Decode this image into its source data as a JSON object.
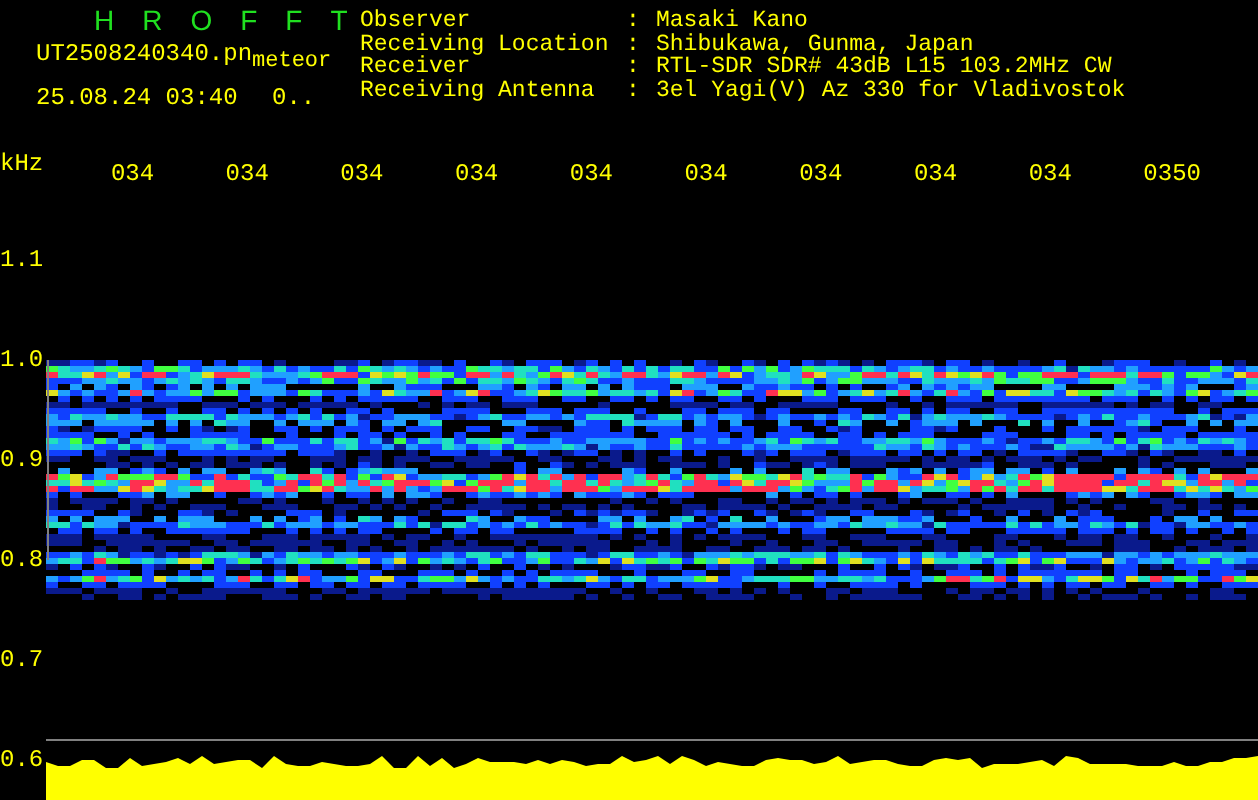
{
  "title": "HROFFT",
  "file": {
    "name": "UT2508240340.pn",
    "tag": "meteor",
    "date": "25.08.24 03:40",
    "count": "0.."
  },
  "info": [
    {
      "label": "Observer",
      "separator": ":",
      "value": "Masaki Kano"
    },
    {
      "label": "Receiving Location",
      "separator": ":",
      "value": "Shibukawa, Gunma, Japan"
    },
    {
      "label": "Receiver",
      "separator": ":",
      "value": "RTL-SDR SDR# 43dB L15 103.2MHz CW"
    },
    {
      "label": "Receiving Antenna",
      "separator": ":",
      "value": "3el Yagi(V) Az 330 for Vladivostok"
    }
  ],
  "x_axis": {
    "unit": "kHz",
    "labels": [
      "034",
      "034",
      "034",
      "034",
      "034",
      "034",
      "034",
      "034",
      "034",
      "0350"
    ]
  },
  "y_axis": {
    "labels": [
      "1.1",
      "1.0",
      "0.9",
      "0.8",
      "0.7",
      "0.6"
    ]
  }
}
